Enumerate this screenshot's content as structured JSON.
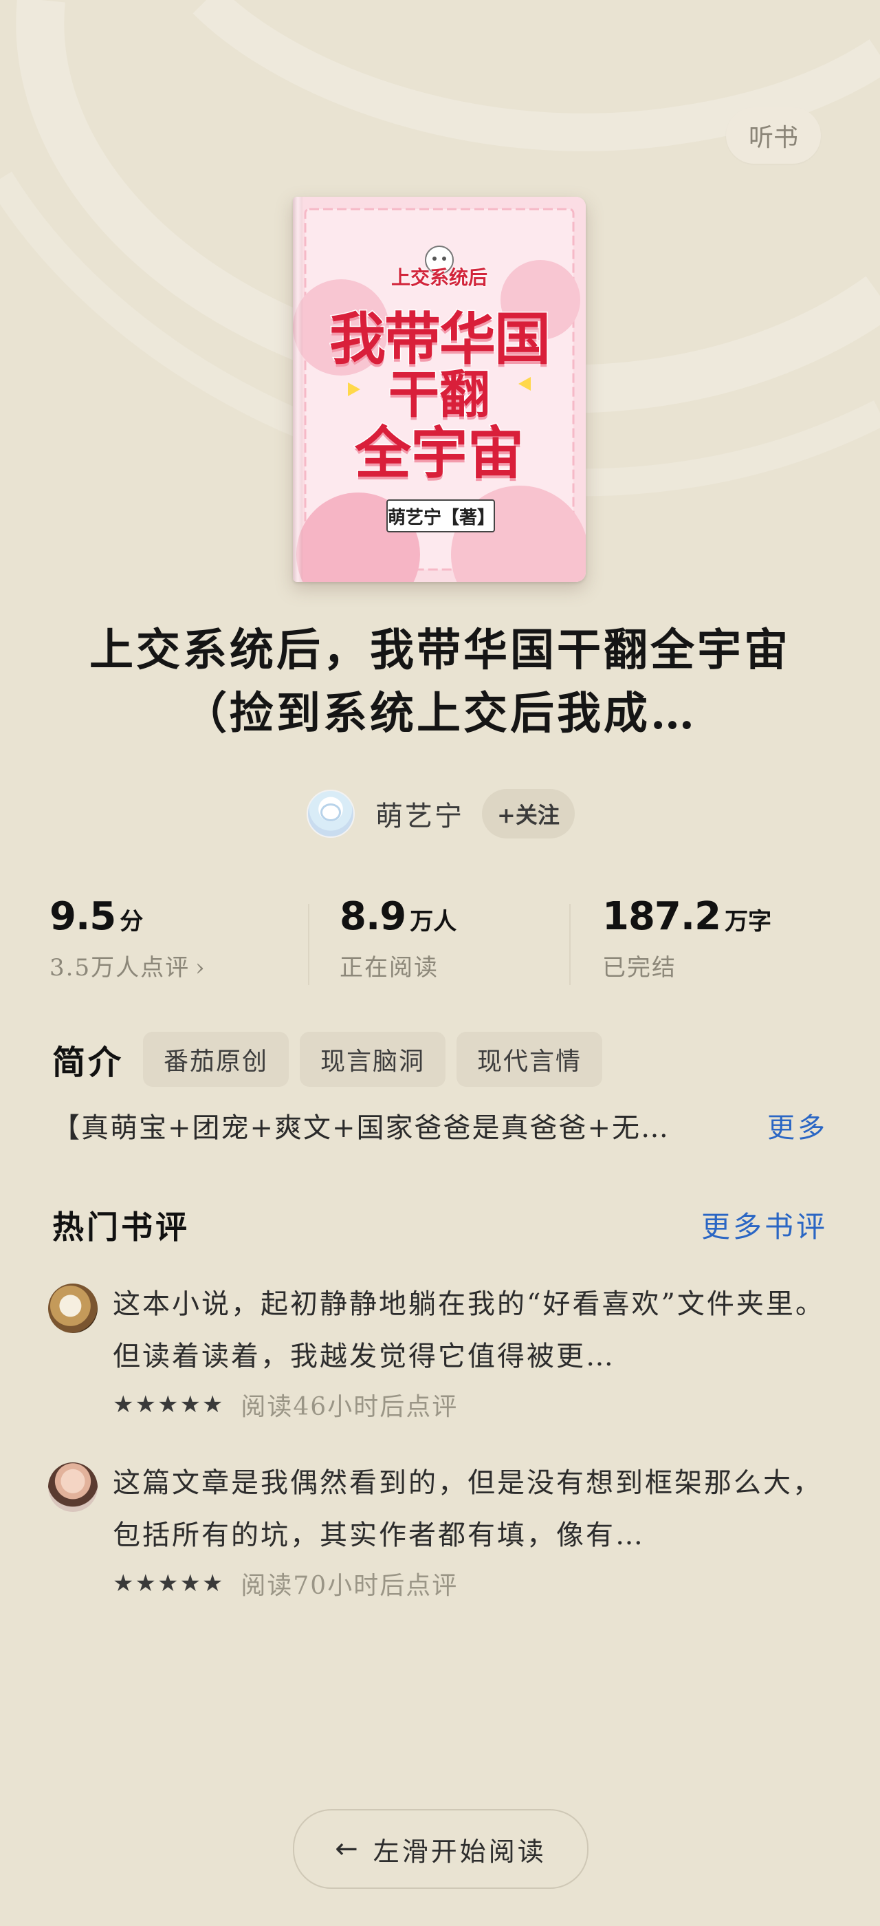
{
  "header": {
    "listen_label": "听书"
  },
  "cover": {
    "subtitle": "上交系统后",
    "title_line1": "我带华国",
    "title_line2": "干翻",
    "title_line3": "全宇宙",
    "author_tag": "萌艺宁【著】"
  },
  "book": {
    "title": "上交系统后，我带华国干翻全宇宙（捡到系统上交后我成…",
    "author": "萌艺宁",
    "follow_label": "+关注"
  },
  "stats": {
    "score": {
      "value": "9.5",
      "unit": "分",
      "label": "3.5万人点评"
    },
    "readers": {
      "value": "8.9",
      "unit": "万人",
      "label": "正在阅读"
    },
    "words": {
      "value": "187.2",
      "unit": "万字",
      "label": "已完结"
    }
  },
  "intro": {
    "heading": "简介",
    "tags": [
      "番茄原创",
      "现言脑洞",
      "现代言情"
    ],
    "text": "【真萌宝+团宠+爽文+国家爸爸是真爸爸+无…",
    "more_label": "更多"
  },
  "reviews": {
    "heading": "热门书评",
    "more_label": "更多书评",
    "items": [
      {
        "text": "这本小说，起初静静地躺在我的“好看喜欢”文件夹里。但读着读着，我越发觉得它值得被更…",
        "stars": "★★★★★",
        "note": "阅读46小时后点评"
      },
      {
        "text": "这篇文章是我偶然看到的，但是没有想到框架那么大，包括所有的坑，其实作者都有填，像有…",
        "stars": "★★★★★",
        "note": "阅读70小时后点评"
      }
    ]
  },
  "footer": {
    "start_label": "左滑开始阅读"
  },
  "colors": {
    "background": "#e9e3d2",
    "link": "#2a66c4",
    "cover_red": "#d91f3a"
  }
}
